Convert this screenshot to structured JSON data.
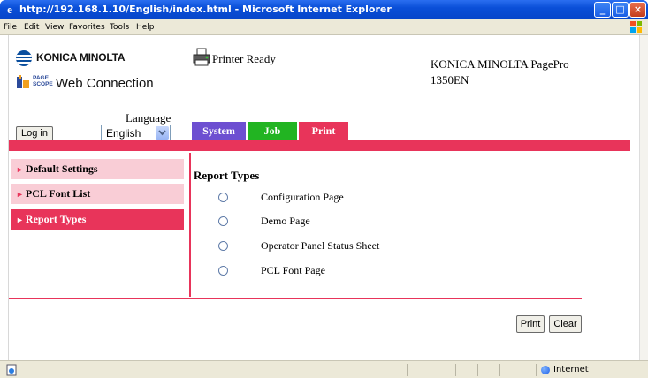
{
  "window": {
    "title": "http://192.168.1.10/English/index.html - Microsoft Internet Explorer"
  },
  "menu": [
    "File",
    "Edit",
    "View",
    "Favorites",
    "Tools",
    "Help"
  ],
  "branding": {
    "brand": "KONICA MINOLTA",
    "pagescope_small_top": "PAGE",
    "pagescope_small_bottom": "SCOPE",
    "product": "Web Connection"
  },
  "printer": {
    "status": "Printer Ready",
    "model_line1": "KONICA MINOLTA PagePro",
    "model_line2": "1350EN"
  },
  "login": {
    "button_label": "Log in"
  },
  "language": {
    "label": "Language",
    "selected": "English"
  },
  "tabs": [
    {
      "label": "System"
    },
    {
      "label": "Job"
    },
    {
      "label": "Print"
    }
  ],
  "sidebar": {
    "items": [
      {
        "label": "Default Settings"
      },
      {
        "label": "PCL Font List"
      },
      {
        "label": "Report Types"
      }
    ]
  },
  "main": {
    "title": "Report Types",
    "options": [
      {
        "label": "Configuration Page"
      },
      {
        "label": "Demo Page"
      },
      {
        "label": "Operator Panel Status Sheet"
      },
      {
        "label": "PCL Font Page"
      }
    ]
  },
  "actions": {
    "print_label": "Print",
    "clear_label": "Clear"
  },
  "statusbar": {
    "zone": "Internet"
  },
  "colors": {
    "accent": "#e8345a",
    "system_tab": "#6d4fd1",
    "job_tab": "#22b422",
    "sidebar_inactive": "#f9cdd6"
  }
}
